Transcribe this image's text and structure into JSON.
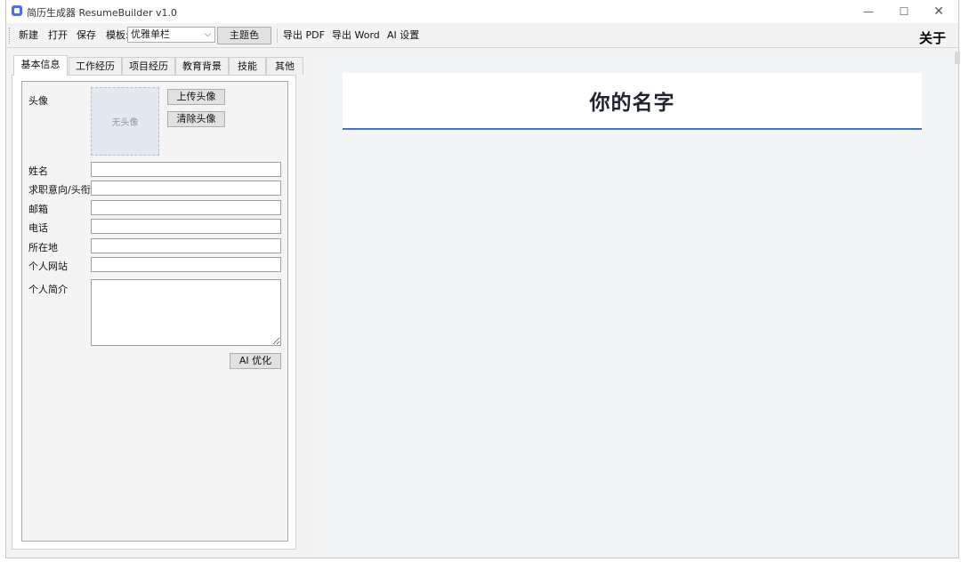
{
  "window": {
    "title": "简历生成器 ResumeBuilder  v1.0",
    "controls": {
      "minimize": "—",
      "maximize": "☐",
      "close": "✕"
    }
  },
  "toolbar": {
    "new": "新建",
    "open": "打开",
    "save": "保存",
    "template_label": "模板:",
    "template_value": "优雅单栏",
    "theme_color": "主题色",
    "export_pdf": "导出 PDF",
    "export_word": "导出 Word",
    "ai_settings": "AI 设置",
    "about": "关于"
  },
  "tabs": [
    {
      "label": "基本信息",
      "active": true
    },
    {
      "label": "工作经历",
      "active": false
    },
    {
      "label": "项目经历",
      "active": false
    },
    {
      "label": "教育背景",
      "active": false
    },
    {
      "label": "技能",
      "active": false
    },
    {
      "label": "其他",
      "active": false
    }
  ],
  "form": {
    "avatar_label": "头像",
    "avatar_placeholder": "无头像",
    "upload_avatar": "上传头像",
    "clear_avatar": "清除头像",
    "fields": [
      {
        "label": "姓名",
        "value": ""
      },
      {
        "label": "求职意向/头衔",
        "value": ""
      },
      {
        "label": "邮箱",
        "value": ""
      },
      {
        "label": "电话",
        "value": ""
      },
      {
        "label": "所在地",
        "value": ""
      },
      {
        "label": "个人网站",
        "value": ""
      }
    ],
    "summary_label": "个人简介",
    "summary_value": "",
    "ai_optimize": "AI 优化"
  },
  "preview": {
    "name": "你的名字",
    "accent_color": "#3f74d6"
  }
}
